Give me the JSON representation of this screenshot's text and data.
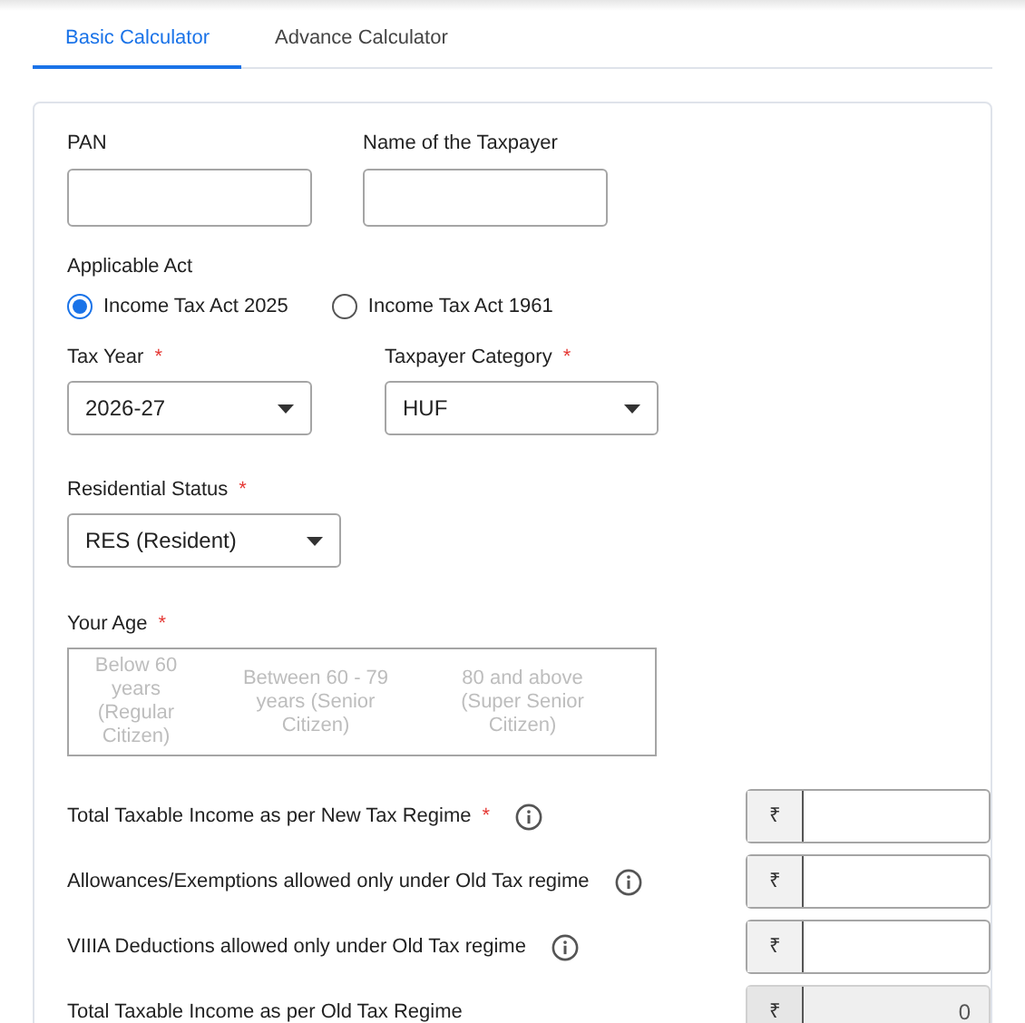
{
  "tabs": [
    {
      "label": "Basic Calculator",
      "selected": true
    },
    {
      "label": "Advance Calculator",
      "selected": false
    }
  ],
  "identity_fields": [
    {
      "label": "PAN"
    },
    {
      "label": "Name of the Taxpayer"
    }
  ],
  "applicable_act": {
    "label": "Applicable Act",
    "options": [
      {
        "label": "Income Tax Act 2025",
        "selected": true
      },
      {
        "label": "Income Tax Act 1961",
        "selected": false
      }
    ]
  },
  "selects": [
    {
      "label": "Tax Year",
      "required_mark": "*",
      "value": "2026-27"
    },
    {
      "label": "Taxpayer Category",
      "required_mark": "*",
      "value": "HUF"
    }
  ],
  "residential_status": {
    "label": "Residential Status",
    "required_mark": "*",
    "value": "RES (Resident)"
  },
  "age": {
    "label": "Your Age",
    "required_mark": "*",
    "disabled": true,
    "options": [
      {
        "label": "Below 60 years (Regular Citizen)",
        "selected": false
      },
      {
        "label": "Between 60 - 79 years (Senior Citizen)",
        "selected": false
      },
      {
        "label": "80 and above (Super Senior Citizen)",
        "selected": false
      }
    ]
  },
  "income_rows": [
    {
      "label": "Total Taxable Income as per New Tax Regime",
      "required_mark": "*",
      "info": true,
      "currency": "₹",
      "disabled": false
    },
    {
      "label": "Allowances/Exemptions allowed only under Old Tax regime",
      "info": true,
      "currency": "₹",
      "disabled": false
    },
    {
      "label": "VIIIA Deductions allowed only under Old Tax regime",
      "info": true,
      "currency": "₹",
      "disabled": false
    },
    {
      "label": "Total Taxable Income as per Old Tax Regime",
      "info": false,
      "currency": "₹",
      "value": "0",
      "disabled": true
    }
  ]
}
